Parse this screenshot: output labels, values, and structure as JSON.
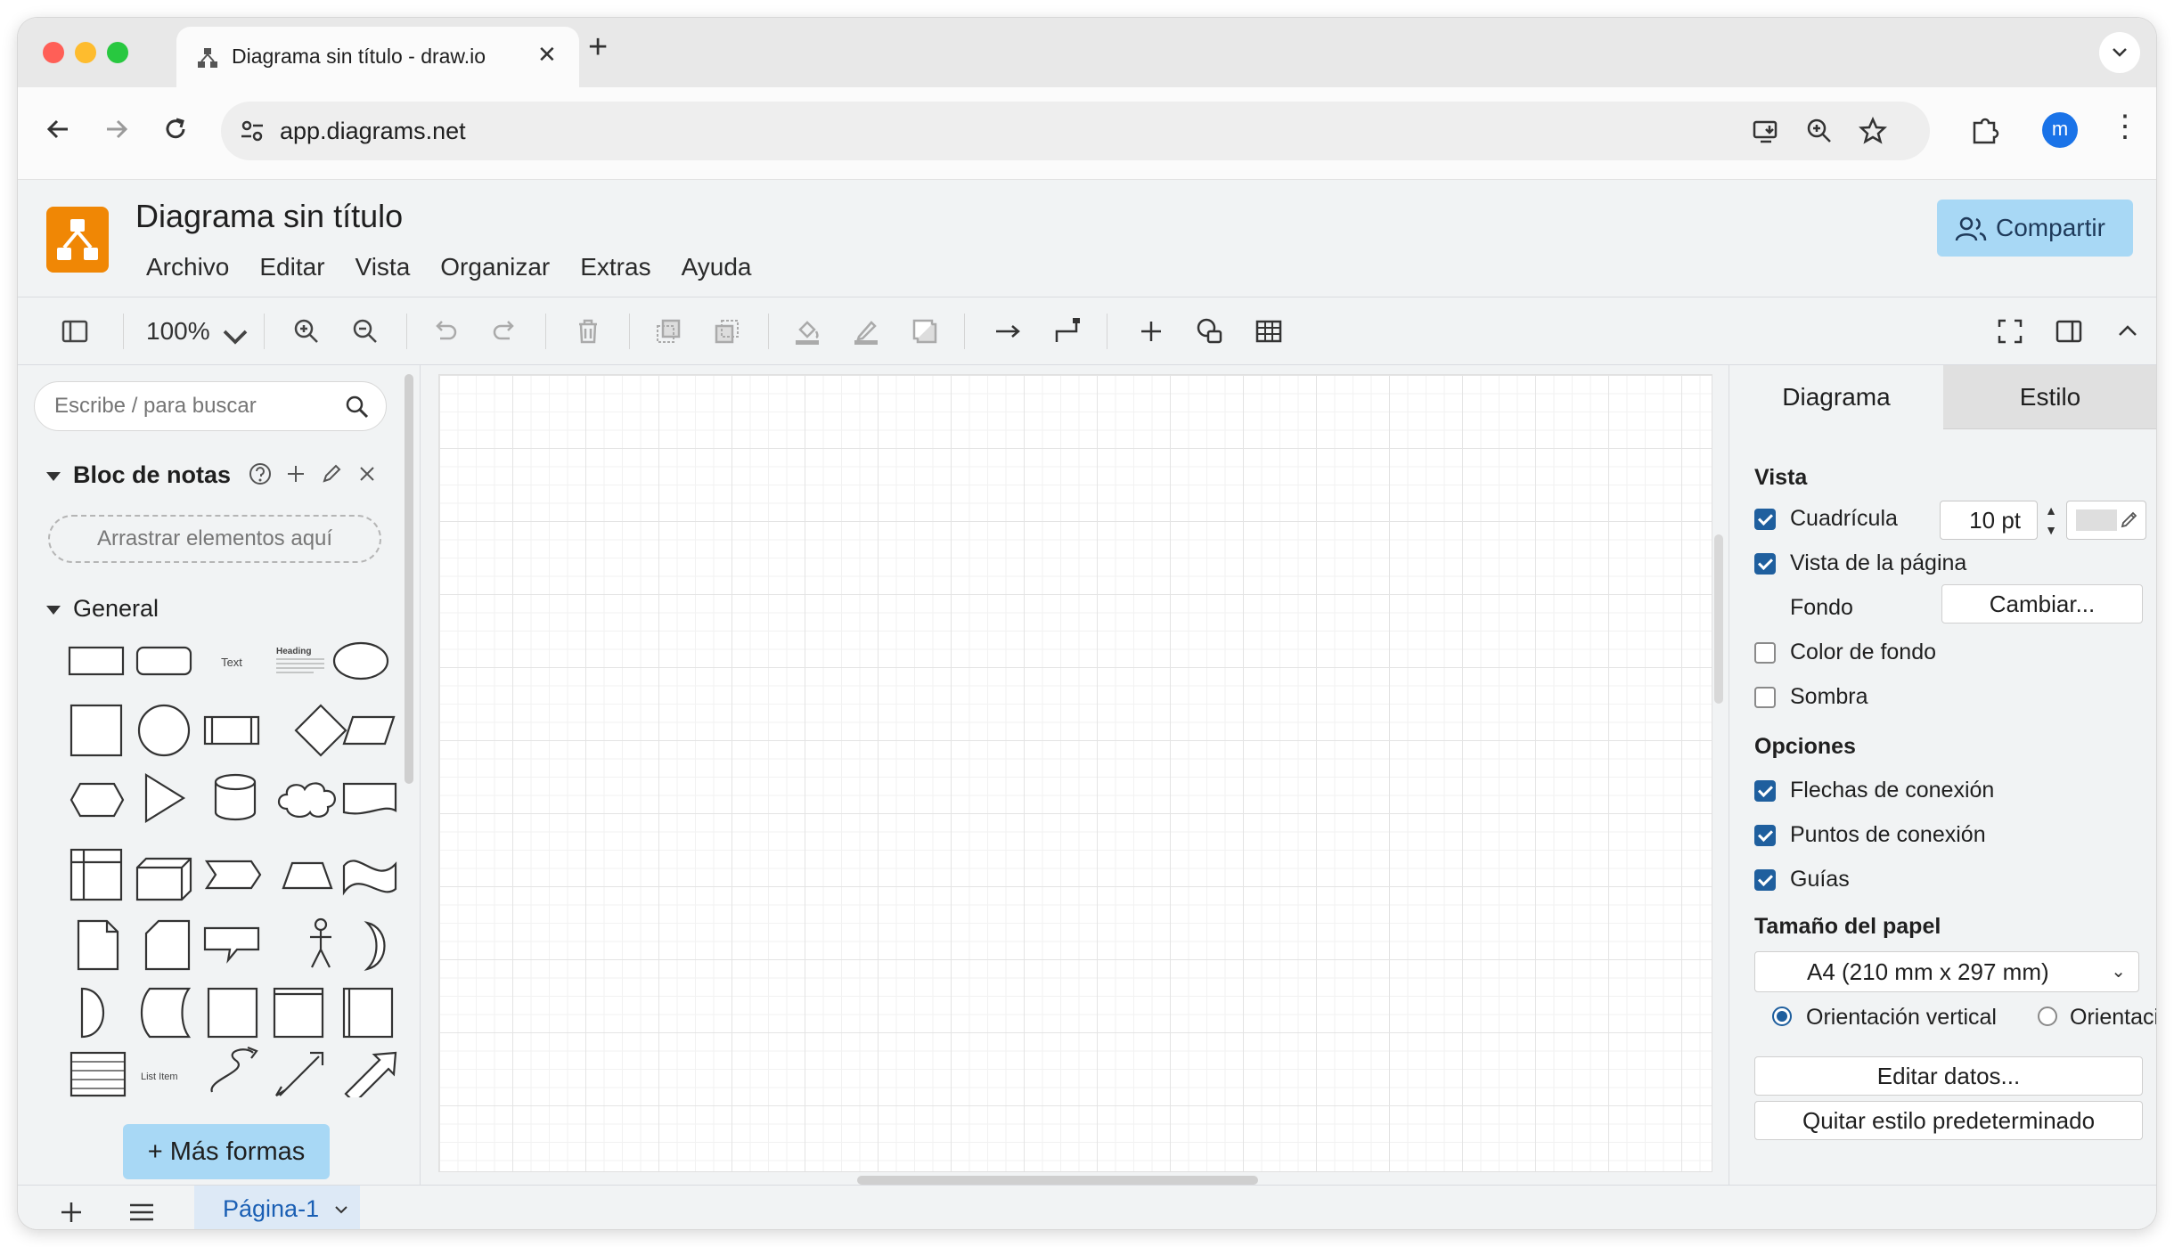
{
  "browser": {
    "tab_title": "Diagrama sin título - draw.io",
    "url": "app.diagrams.net",
    "avatar_letter": "m",
    "colors": {
      "close": "#ff5f57",
      "minimize": "#febc2e",
      "maximize": "#28c840"
    }
  },
  "app": {
    "title": "Diagrama sin título",
    "menu": [
      "Archivo",
      "Editar",
      "Vista",
      "Organizar",
      "Extras",
      "Ayuda"
    ],
    "share_label": "Compartir",
    "accent_color": "#f08705"
  },
  "toolbar": {
    "zoom": "100%",
    "icons": [
      "sidebar-toggle-icon",
      "zoom-in-icon",
      "zoom-out-icon",
      "undo-icon",
      "redo-icon",
      "delete-icon",
      "to-front-icon",
      "to-back-icon",
      "fill-color-icon",
      "line-color-icon",
      "shadow-icon",
      "connection-icon",
      "waypoints-icon",
      "insert-icon",
      "shapes-icon",
      "table-icon",
      "fullscreen-icon",
      "format-panel-icon",
      "collapse-icon"
    ]
  },
  "sidebar": {
    "search_placeholder": "Escribe / para buscar",
    "scratchpad_title": "Bloc de notas",
    "scratchpad_drop": "Arrastrar elementos aquí",
    "general_title": "General",
    "text_shape_label": "Text",
    "heading_shape_label": "Heading",
    "list_item_label": "List Item",
    "more_shapes": "+ Más formas"
  },
  "format": {
    "tab_diagram": "Diagrama",
    "tab_style": "Estilo",
    "view_head": "Vista",
    "grid_label": "Cuadrícula",
    "grid_checked": true,
    "grid_size": "10 pt",
    "page_view_label": "Vista de la página",
    "page_view_checked": true,
    "background_label": "Fondo",
    "change_button": "Cambiar...",
    "bg_color_label": "Color de fondo",
    "bg_color_checked": false,
    "shadow_label": "Sombra",
    "shadow_checked": false,
    "options_head": "Opciones",
    "connection_arrows": "Flechas de conexión",
    "connection_points": "Puntos de conexión",
    "guides": "Guías",
    "paper_head": "Tamaño del papel",
    "paper_size": "A4 (210 mm x 297 mm)",
    "orientation_portrait": "Orientación vertical",
    "orientation_landscape": "Orientació",
    "edit_data": "Editar datos...",
    "clear_style": "Quitar estilo predeterminado"
  },
  "pages": {
    "current": "Página-1"
  }
}
